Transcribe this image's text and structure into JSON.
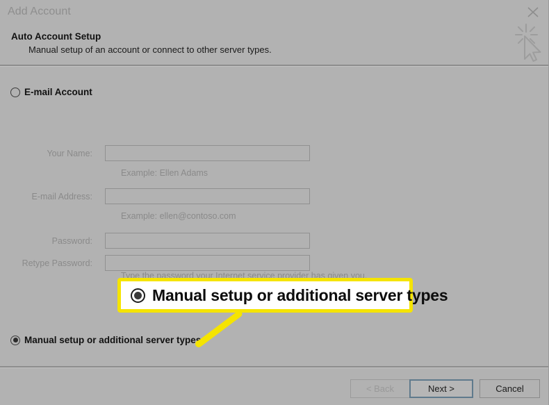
{
  "window": {
    "title": "Add Account",
    "close_icon": "close-icon"
  },
  "header": {
    "title": "Auto Account Setup",
    "subtitle": "Manual setup of an account or connect to other server types.",
    "icon": "magic-wand-cursor-icon"
  },
  "options": {
    "email_account": {
      "label": "E-mail Account",
      "selected": false
    },
    "manual_setup": {
      "label": "Manual setup or additional server types",
      "selected": true
    }
  },
  "form": {
    "your_name": {
      "label": "Your Name:",
      "value": "",
      "hint": "Example: Ellen Adams"
    },
    "email_address": {
      "label": "E-mail Address:",
      "value": "",
      "hint": "Example: ellen@contoso.com"
    },
    "password": {
      "label": "Password:",
      "value": ""
    },
    "retype_password": {
      "label": "Retype Password:",
      "value": "",
      "hint": "Type the password your Internet service provider has given you."
    }
  },
  "callout": {
    "label": "Manual setup or additional server types",
    "border_color": "#f5e400",
    "background_color": "#ffffff",
    "arrow_color": "#f5e400"
  },
  "footer": {
    "back": "< Back",
    "next": "Next >",
    "cancel": "Cancel"
  }
}
